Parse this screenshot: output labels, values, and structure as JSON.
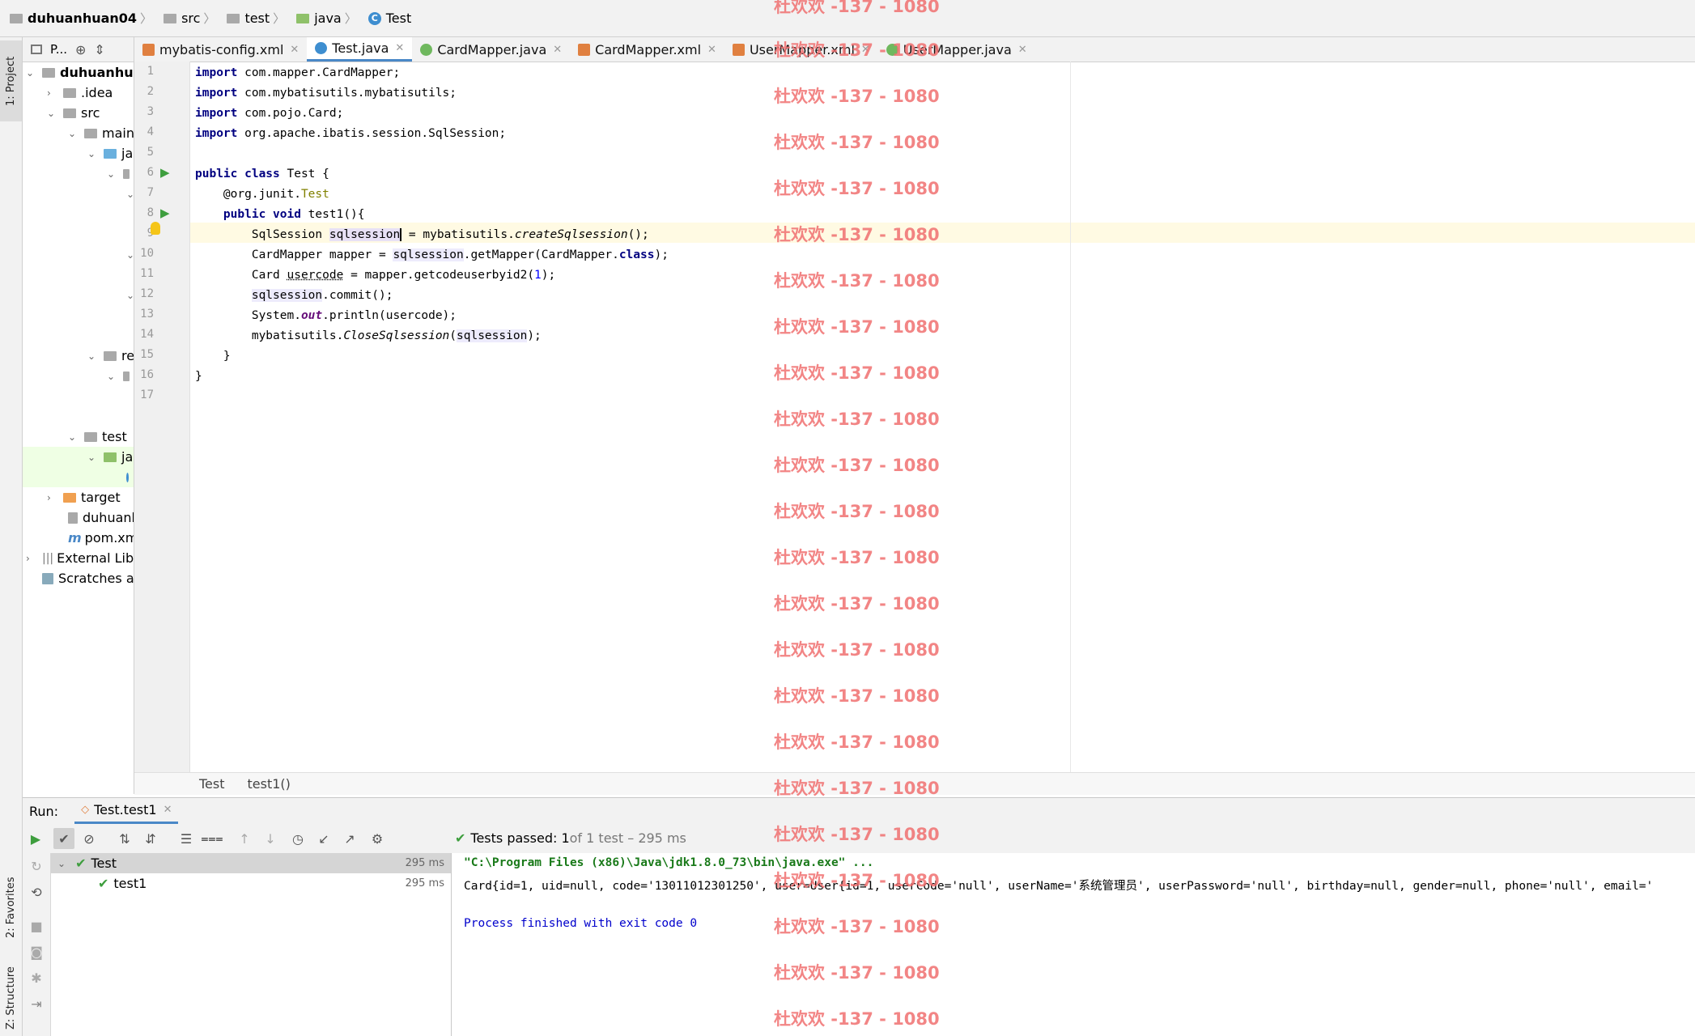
{
  "breadcrumb": {
    "project": "duhuanhuan04",
    "items": [
      "src",
      "test",
      "java",
      "Test"
    ]
  },
  "left_stripe": {
    "project_tab": "1: Project",
    "favorites_tab": "2: Favorites",
    "structure_tab": "Z: Structure"
  },
  "project_panel": {
    "header": "P...",
    "tree": [
      {
        "label": "duhuanhua",
        "bold": true
      },
      {
        "label": ".idea"
      },
      {
        "label": "src"
      },
      {
        "label": "main"
      },
      {
        "label": "ja"
      },
      {
        "label": "re"
      },
      {
        "label": "test"
      },
      {
        "label": "ja"
      },
      {
        "label": "target"
      },
      {
        "label": "duhuanh"
      },
      {
        "label": "pom.xml"
      },
      {
        "label": "External Libr"
      },
      {
        "label": "Scratches ar"
      }
    ]
  },
  "editor_tabs": [
    {
      "label": "mybatis-config.xml",
      "icon": "xml-icon"
    },
    {
      "label": "Test.java",
      "icon": "java-class-icon",
      "active": true
    },
    {
      "label": "CardMapper.java",
      "icon": "interface-icon"
    },
    {
      "label": "CardMapper.xml",
      "icon": "xml-icon"
    },
    {
      "label": "UserMapper.xml",
      "icon": "xml-icon"
    },
    {
      "label": "UserMapper.java",
      "icon": "interface-icon"
    }
  ],
  "code": {
    "line_numbers": [
      "1",
      "2",
      "3",
      "4",
      "5",
      "6",
      "7",
      "8",
      "9",
      "10",
      "11",
      "12",
      "13",
      "14",
      "15",
      "16",
      "17"
    ],
    "l1a": "import",
    "l1b": " com.mapper.CardMapper;",
    "l2a": "import",
    "l2b": " com.mybatisutils.mybatisutils;",
    "l3a": "import",
    "l3b": " com.pojo.Card;",
    "l4a": "import",
    "l4b": " org.apache.ibatis.session.SqlSession;",
    "l6a": "public class",
    "l6b": " Test {",
    "l7a": "    @org.junit.",
    "l7b": "Test",
    "l8a": "    public void",
    "l8b": " test1(){",
    "l9a": "        SqlSession ",
    "l9b": "sqlsession",
    "l9c": " = mybatisutils.",
    "l9d": "createSqlsession",
    "l9e": "();",
    "l10a": "        CardMapper mapper = ",
    "l10b": "sqlsession",
    "l10c": ".getMapper(CardMapper.",
    "l10d": "class",
    "l10e": ");",
    "l11a": "        Card ",
    "l11b": "usercode",
    "l11c": " = mapper.getcodeuserbyid2(",
    "l11d": "1",
    "l11e": ");",
    "l12a": "        ",
    "l12b": "sqlsession",
    "l12c": ".commit();",
    "l13a": "        System.",
    "l13b": "out",
    "l13c": ".println(usercode);",
    "l14a": "        mybatisutils.",
    "l14b": "CloseSqlsession",
    "l14c": "(",
    "l14d": "sqlsession",
    "l14e": ");",
    "l15": "    }",
    "l16": "}"
  },
  "editor_breadcrumb": [
    "Test",
    "test1()"
  ],
  "run": {
    "label": "Run:",
    "tab": "Test.test1",
    "status_prefix": "Tests passed:",
    "status_count": "1",
    "status_suffix": " of 1 test – 295 ms",
    "tests": [
      {
        "name": "Test",
        "time": "295 ms"
      },
      {
        "name": "test1",
        "time": "295 ms"
      }
    ],
    "console": [
      "\"C:\\Program Files (x86)\\Java\\jdk1.8.0_73\\bin\\java.exe\" ...",
      "Card{id=1, uid=null, code='13011012301250', user=User{id=1, userCode='null', userName='系统管理员', userPassword='null', birthday=null, gender=null, phone='null', email='",
      "",
      "Process finished with exit code 0"
    ]
  },
  "watermark": "杜欢欢 -137 - 1080",
  "colors": {
    "keyword": "#000080",
    "annotation": "#808000",
    "watermark": "#f07070",
    "pass_green": "#3e9e3e",
    "active_tab_underline": "#4a88c7"
  }
}
